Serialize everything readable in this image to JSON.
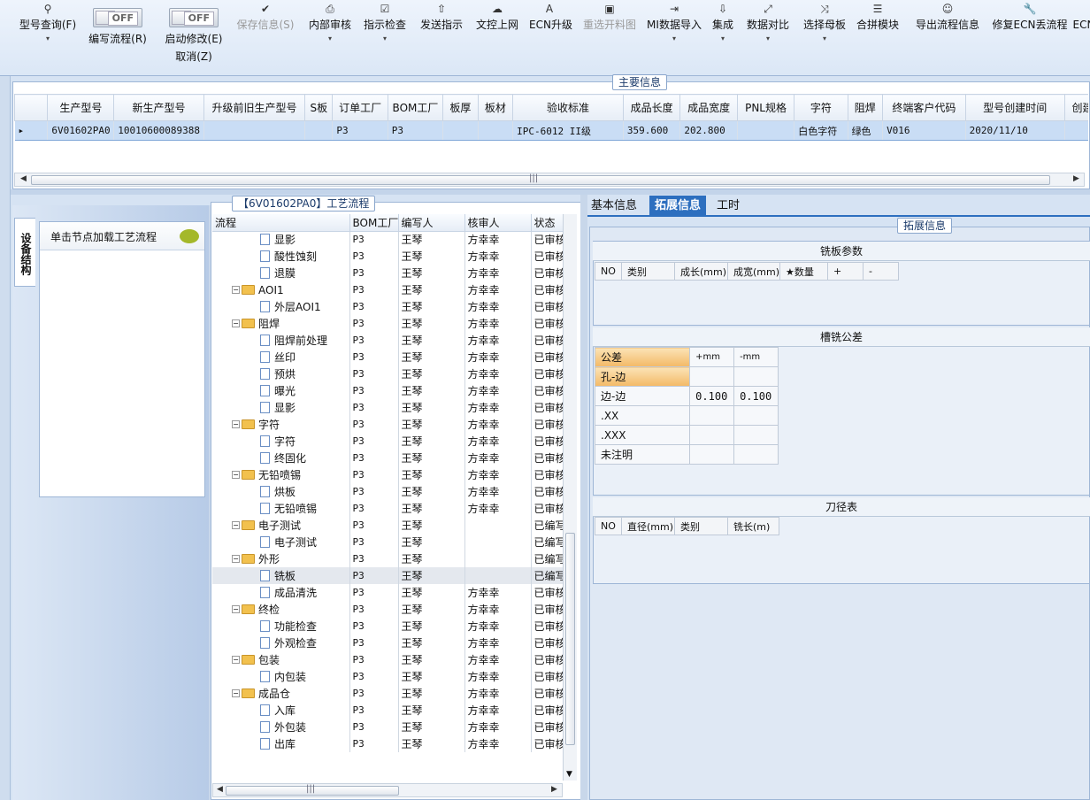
{
  "toolbar": {
    "items": [
      {
        "label": "型号查询(F)",
        "icon": "search-icon",
        "dropdown": true
      },
      {
        "label": "编写流程(R)",
        "toggle": "OFF"
      },
      {
        "label": "启动修改(E)",
        "sub": "取消(Z)",
        "toggle": "OFF"
      },
      {
        "label": "保存信息(S)",
        "icon": "check-icon",
        "disabled": true
      },
      {
        "label": "内部审核",
        "icon": "print-icon",
        "dropdown": true
      },
      {
        "label": "指示检查",
        "icon": "checkbox-icon",
        "dropdown": true
      },
      {
        "label": "发送指示",
        "icon": "upload-icon"
      },
      {
        "label": "文控上网",
        "icon": "cloud-upload-icon"
      },
      {
        "label": "ECN升级",
        "icon": "font-a-icon"
      },
      {
        "label": "重选开料图",
        "icon": "picture-icon",
        "disabled": true
      },
      {
        "label": "MI数据导入",
        "icon": "import-icon",
        "dropdown": true
      },
      {
        "label": "集成",
        "icon": "download-icon",
        "dropdown": true
      },
      {
        "label": "数据对比",
        "icon": "compare-icon",
        "dropdown": true
      },
      {
        "label": "选择母板",
        "icon": "shuffle-icon",
        "dropdown": true
      },
      {
        "label": "合拼模块",
        "icon": "list-icon"
      },
      {
        "label": "导出流程信息",
        "icon": "smile-icon"
      },
      {
        "label": "修复ECN丢流程",
        "icon": "wrench-icon"
      },
      {
        "label": "ECN",
        "icon": "none"
      }
    ],
    "toggle_text": "OFF"
  },
  "main_info": {
    "title": "主要信息",
    "columns": [
      "生产型号",
      "新生产型号",
      "升级前旧生产型号",
      "S板",
      "订单工厂",
      "BOM工厂",
      "板厚",
      "板材",
      "验收标准",
      "成品长度",
      "成品宽度",
      "PNL规格",
      "字符",
      "阻焊",
      "终端客户代码",
      "型号创建时间",
      "创建人"
    ],
    "row": [
      "6V01602PA0",
      "10010600089388",
      "",
      "",
      "P3",
      "P3",
      "",
      "",
      "IPC-6012 II级",
      "359.600",
      "202.800",
      "",
      "白色字符",
      "绿色",
      "V016",
      "2020/11/10",
      ""
    ],
    "scroll_mark": "|||"
  },
  "left_panel": {
    "vertical_tab": "设备结构",
    "hint": "单击节点加载工艺流程"
  },
  "process": {
    "title": "【6V01602PA0】工艺流程",
    "columns": [
      "流程",
      "BOM工厂",
      "编写人",
      "核审人",
      "状态"
    ],
    "rows": [
      {
        "name": "显影",
        "level": 2,
        "bom": "P3",
        "writer": "王琴",
        "checker": "方幸幸",
        "status": "已审核"
      },
      {
        "name": "酸性蚀刻",
        "level": 2,
        "bom": "P3",
        "writer": "王琴",
        "checker": "方幸幸",
        "status": "已审核"
      },
      {
        "name": "退膜",
        "level": 2,
        "bom": "P3",
        "writer": "王琴",
        "checker": "方幸幸",
        "status": "已审核"
      },
      {
        "name": "AOI1",
        "level": 1,
        "bom": "P3",
        "writer": "王琴",
        "checker": "方幸幸",
        "status": "已审核"
      },
      {
        "name": "外层AOI1",
        "level": 2,
        "bom": "P3",
        "writer": "王琴",
        "checker": "方幸幸",
        "status": "已审核"
      },
      {
        "name": "阻焊",
        "level": 1,
        "bom": "P3",
        "writer": "王琴",
        "checker": "方幸幸",
        "status": "已审核"
      },
      {
        "name": "阻焊前处理",
        "level": 2,
        "bom": "P3",
        "writer": "王琴",
        "checker": "方幸幸",
        "status": "已审核"
      },
      {
        "name": "丝印",
        "level": 2,
        "bom": "P3",
        "writer": "王琴",
        "checker": "方幸幸",
        "status": "已审核"
      },
      {
        "name": "预烘",
        "level": 2,
        "bom": "P3",
        "writer": "王琴",
        "checker": "方幸幸",
        "status": "已审核"
      },
      {
        "name": "曝光",
        "level": 2,
        "bom": "P3",
        "writer": "王琴",
        "checker": "方幸幸",
        "status": "已审核"
      },
      {
        "name": "显影",
        "level": 2,
        "bom": "P3",
        "writer": "王琴",
        "checker": "方幸幸",
        "status": "已审核"
      },
      {
        "name": "字符",
        "level": 1,
        "bom": "P3",
        "writer": "王琴",
        "checker": "方幸幸",
        "status": "已审核"
      },
      {
        "name": "字符",
        "level": 2,
        "bom": "P3",
        "writer": "王琴",
        "checker": "方幸幸",
        "status": "已审核"
      },
      {
        "name": "终固化",
        "level": 2,
        "bom": "P3",
        "writer": "王琴",
        "checker": "方幸幸",
        "status": "已审核"
      },
      {
        "name": "无铅喷锡",
        "level": 1,
        "bom": "P3",
        "writer": "王琴",
        "checker": "方幸幸",
        "status": "已审核"
      },
      {
        "name": "烘板",
        "level": 2,
        "bom": "P3",
        "writer": "王琴",
        "checker": "方幸幸",
        "status": "已审核"
      },
      {
        "name": "无铅喷锡",
        "level": 2,
        "bom": "P3",
        "writer": "王琴",
        "checker": "方幸幸",
        "status": "已审核"
      },
      {
        "name": "电子测试",
        "level": 1,
        "bom": "P3",
        "writer": "王琴",
        "checker": "",
        "status": "已编写"
      },
      {
        "name": "电子测试",
        "level": 2,
        "bom": "P3",
        "writer": "王琴",
        "checker": "",
        "status": "已编写"
      },
      {
        "name": "外形",
        "level": 1,
        "bom": "P3",
        "writer": "王琴",
        "checker": "",
        "status": "已编写"
      },
      {
        "name": "铣板",
        "level": 2,
        "bom": "P3",
        "writer": "王琴",
        "checker": "",
        "status": "已编写",
        "selected": true
      },
      {
        "name": "成品清洗",
        "level": 2,
        "bom": "P3",
        "writer": "王琴",
        "checker": "方幸幸",
        "status": "已审核"
      },
      {
        "name": "终检",
        "level": 1,
        "bom": "P3",
        "writer": "王琴",
        "checker": "方幸幸",
        "status": "已审核"
      },
      {
        "name": "功能检查",
        "level": 2,
        "bom": "P3",
        "writer": "王琴",
        "checker": "方幸幸",
        "status": "已审核"
      },
      {
        "name": "外观检查",
        "level": 2,
        "bom": "P3",
        "writer": "王琴",
        "checker": "方幸幸",
        "status": "已审核"
      },
      {
        "name": "包装",
        "level": 1,
        "bom": "P3",
        "writer": "王琴",
        "checker": "方幸幸",
        "status": "已审核"
      },
      {
        "name": "内包装",
        "level": 2,
        "bom": "P3",
        "writer": "王琴",
        "checker": "方幸幸",
        "status": "已审核"
      },
      {
        "name": "成品仓",
        "level": 1,
        "bom": "P3",
        "writer": "王琴",
        "checker": "方幸幸",
        "status": "已审核"
      },
      {
        "name": "入库",
        "level": 2,
        "bom": "P3",
        "writer": "王琴",
        "checker": "方幸幸",
        "status": "已审核"
      },
      {
        "name": "外包装",
        "level": 2,
        "bom": "P3",
        "writer": "王琴",
        "checker": "方幸幸",
        "status": "已审核"
      },
      {
        "name": "出库",
        "level": 2,
        "bom": "P3",
        "writer": "王琴",
        "checker": "方幸幸",
        "status": "已审核"
      }
    ],
    "scroll_mark": "|||"
  },
  "right_panel": {
    "tabs": [
      "基本信息",
      "拓展信息",
      "工时"
    ],
    "active_tab": "拓展信息",
    "group_title": "拓展信息",
    "milling_params": {
      "title": "铣板参数",
      "columns": [
        "NO",
        "类别",
        "成长(mm)",
        "成宽(mm)",
        "★数量",
        "+",
        "-"
      ]
    },
    "slot_tolerance": {
      "title": "槽铣公差",
      "header": [
        "公差",
        "+mm",
        "-mm"
      ],
      "rows": [
        {
          "label": "孔-边",
          "plus": "",
          "minus": ""
        },
        {
          "label": "边-边",
          "plus": "0.100",
          "minus": "0.100"
        },
        {
          "label": ".XX",
          "plus": "",
          "minus": ""
        },
        {
          "label": ".XXX",
          "plus": "",
          "minus": ""
        },
        {
          "label": "未注明",
          "plus": "",
          "minus": ""
        }
      ]
    },
    "cutter_table": {
      "title": "刀径表",
      "columns": [
        "NO",
        "直径(mm)",
        "类别",
        "铣长(m)"
      ]
    }
  },
  "colors": {
    "accent": "#1f5fa8",
    "selected_row": "#c9ddf5",
    "active_tab": "#2d6fbf",
    "orange": "#f3b966"
  }
}
